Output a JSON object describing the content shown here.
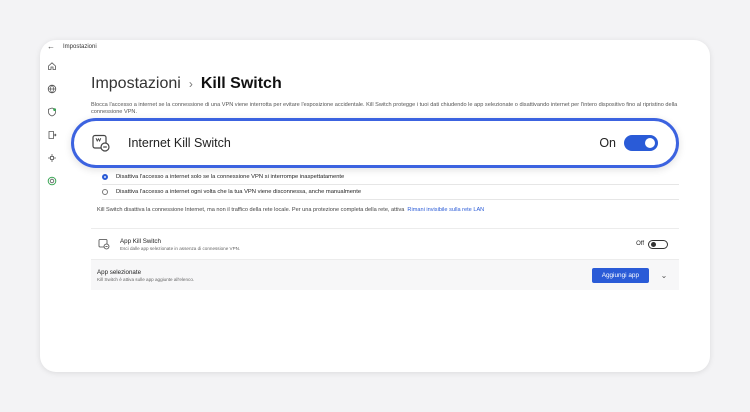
{
  "window": {
    "title": "Impostazioni"
  },
  "breadcrumb": {
    "parent": "Impostazioni",
    "separator": "›",
    "current": "Kill Switch"
  },
  "description": "Blocca l'accesso a internet se la connessione di una VPN viene interrotta per evitare l'esposizione accidentale. Kill Switch protegge i tuoi dati chiudendo le app selezionate o disattivando internet per l'intero dispositivo fino al ripristino della connessione VPN.",
  "kill_switch": {
    "label": "Internet Kill Switch",
    "state_label": "On",
    "enabled": true
  },
  "options": [
    {
      "label": "Disattiva l'accesso a internet solo se la connessione VPN si interrompe inaspettatamente",
      "selected": true
    },
    {
      "label": "Disattiva l'accesso a internet ogni volta che la tua VPN viene disconnessa, anche manualmente",
      "selected": false
    }
  ],
  "note": {
    "text": "Kill Switch disattiva la connessione Internet, ma non il traffico della rete locale. Per una protezione completa della rete, attiva",
    "link": "Rimani invisibile sulla rete LAN"
  },
  "app_kill_switch": {
    "title": "App Kill Switch",
    "subtitle": "Esci dalle app selezionate in assenza di connessione VPN.",
    "state_label": "Off",
    "enabled": false
  },
  "selected_apps": {
    "title": "App selezionate",
    "subtitle": "Kill Switch è attiva sulle app aggiunte all'elenco.",
    "button_label": "Aggiungi app"
  },
  "colors": {
    "accent": "#2a5bd7",
    "highlight_border": "#3c63e0"
  }
}
